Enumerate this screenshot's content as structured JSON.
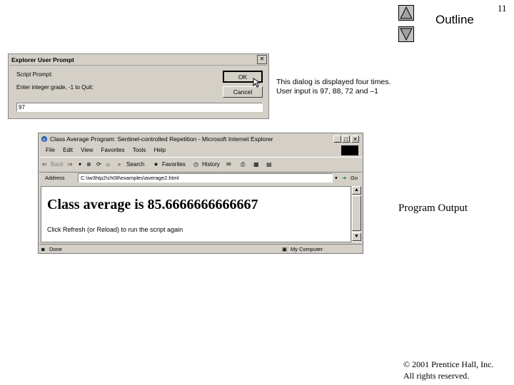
{
  "slide": {
    "page_number": "11",
    "outline_label": "Outline",
    "side_label": "Program Output",
    "caption_line1": "This dialog is displayed four times.",
    "caption_line2": "User input is 97, 88, 72 and –1",
    "copyright_line1": "© 2001 Prentice Hall, Inc.",
    "copyright_line2": "All rights reserved.",
    "nav_up_icon": "triangle-up-icon",
    "nav_down_icon": "triangle-down-icon"
  },
  "prompt_dialog": {
    "title": "Explorer User Prompt",
    "close_glyph": "✕",
    "script_prompt_label": "Script Prompt:",
    "message": "Enter integer grade, -1 to Quit:",
    "ok_label": "OK",
    "cancel_label": "Cancel",
    "input_value": "97"
  },
  "browser": {
    "title": "Class Average Program: Sentinel-controlled Repetition - Microsoft Internet Explorer",
    "menu": [
      "File",
      "Edit",
      "View",
      "Favorites",
      "Tools",
      "Help"
    ],
    "toolbar": {
      "back": "Back",
      "search": "Search",
      "favorites": "Favorites",
      "history": "History"
    },
    "address_label": "Address",
    "address_value": "C:\\iw3htp2\\ch08\\examples\\average2.html",
    "go_label": "Go",
    "heading": "Class average is 85.6666666666667",
    "refresh_text": "Click Refresh (or Reload) to run the script again",
    "status_done": "Done",
    "status_zone": "My Computer"
  }
}
